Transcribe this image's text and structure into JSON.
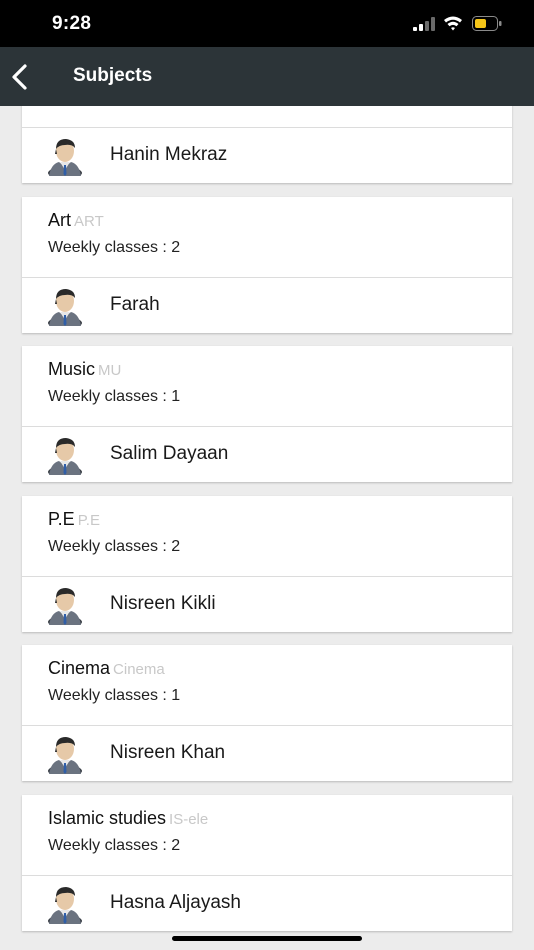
{
  "status": {
    "time": "9:28"
  },
  "nav": {
    "title": "Subjects"
  },
  "top_partial": {
    "teacher": "Hanin Mekraz"
  },
  "subjects": [
    {
      "name": "Art",
      "code": "ART",
      "weekly": "Weekly classes : 2",
      "teacher": "Farah"
    },
    {
      "name": "Music",
      "code": "MU",
      "weekly": "Weekly classes : 1",
      "teacher": "Salim Dayaan"
    },
    {
      "name": "P.E",
      "code": "P.E",
      "weekly": "Weekly classes : 2",
      "teacher": "Nisreen Kikli"
    },
    {
      "name": "Cinema",
      "code": "Cinema",
      "weekly": "Weekly classes : 1",
      "teacher": "Nisreen Khan"
    },
    {
      "name": "Islamic studies",
      "code": "IS-ele",
      "weekly": "Weekly classes : 2",
      "teacher": "Hasna Aljayash"
    }
  ],
  "colors": {
    "navbar": "#2c3438",
    "background": "#ececec",
    "code_text": "#c8c8c8"
  },
  "icons": {
    "back": "chevron-left-icon",
    "avatar": "user-avatar-icon"
  }
}
